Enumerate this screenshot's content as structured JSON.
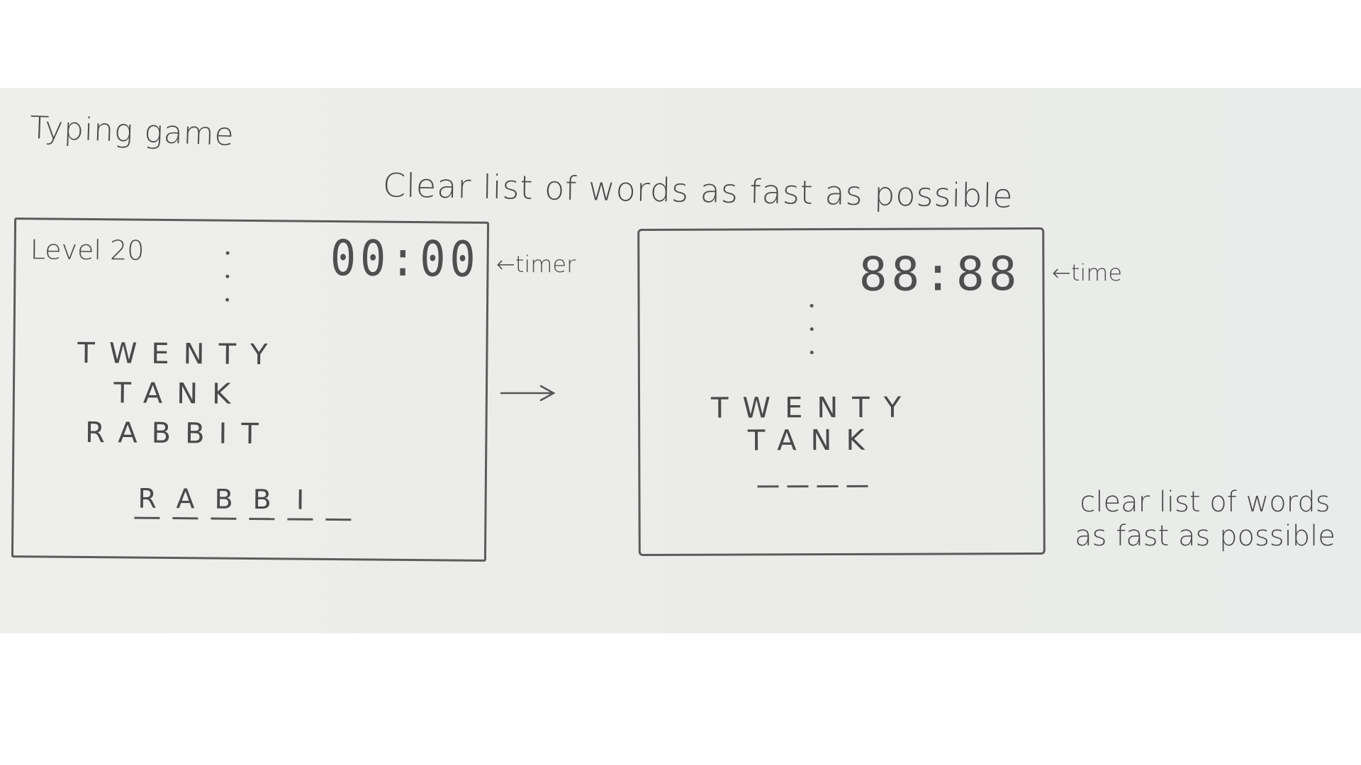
{
  "title": "Typing game",
  "caption": "Clear list of words as fast as possible",
  "panel_game": {
    "level": "Level 20",
    "timer": "00:00",
    "timer_label": "←timer",
    "words": [
      "TWENTY",
      "TANK",
      "RABBIT"
    ],
    "typed": [
      "R",
      "A",
      "B",
      "B",
      "I",
      ""
    ]
  },
  "panel_cleared": {
    "timer": "88:88",
    "timer_label": "←time",
    "words": [
      "TWENTY",
      "TANK"
    ],
    "typed": [
      "",
      "",
      "",
      ""
    ]
  },
  "note": {
    "line1": "clear list of words",
    "line2": "as fast as possible"
  }
}
